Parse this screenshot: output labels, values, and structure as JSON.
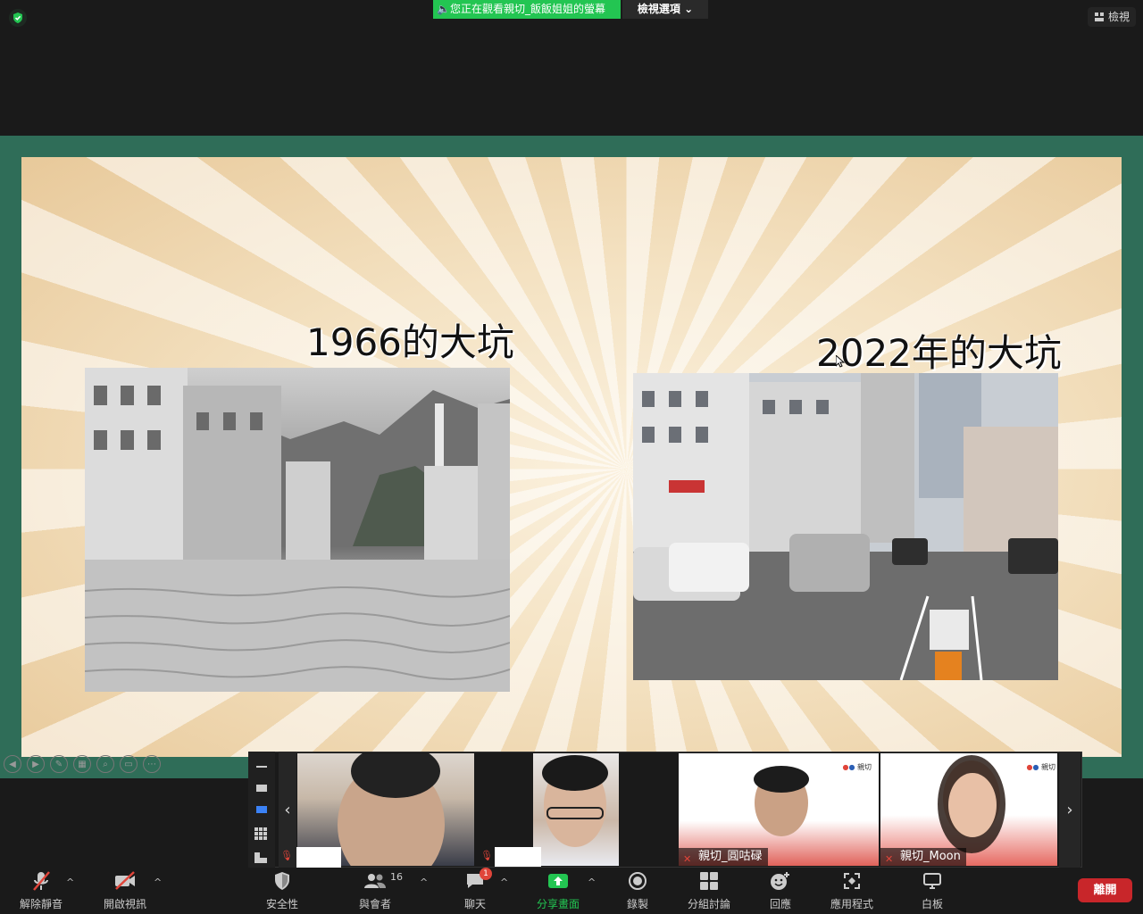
{
  "top_bar": {
    "sharing_banner": "您正在觀看親切_飯飯姐姐的螢幕",
    "view_options": "檢視選項",
    "view_button": "檢視"
  },
  "slide": {
    "title_left": "1966的大坑",
    "title_right": "2022年的大坑"
  },
  "gallery": {
    "participants": [
      {
        "name": ""
      },
      {
        "name": ""
      },
      {
        "name": "親切_圓咕碌"
      },
      {
        "name": "親切_Moon"
      }
    ],
    "logo_text": "親切"
  },
  "toolbar": {
    "unmute": "解除靜音",
    "start_video": "開啟視訊",
    "security": "安全性",
    "participants": "與會者",
    "participants_count": "16",
    "chat": "聊天",
    "chat_badge": "1",
    "share_screen": "分享畫面",
    "record": "錄製",
    "breakout": "分組討論",
    "reactions": "回應",
    "apps": "應用程式",
    "whiteboard": "白板",
    "leave": "離開"
  },
  "colors": {
    "share_green": "#23c552",
    "frame_green": "#2f6d58",
    "leave_red": "#c8262a"
  }
}
